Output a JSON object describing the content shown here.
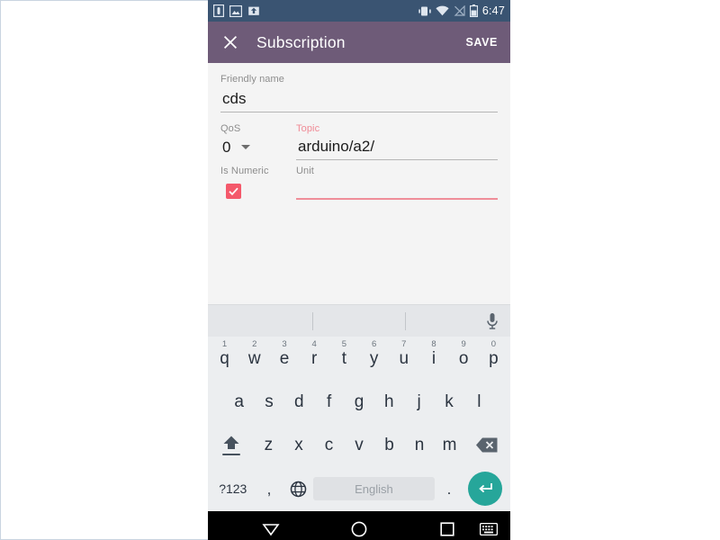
{
  "statusbar": {
    "time": "6:47",
    "left_icons": [
      "sim-card-icon",
      "image-icon",
      "app-update-icon"
    ],
    "right_icons": [
      "vibrate-icon",
      "wifi-icon",
      "signal-off-icon",
      "battery-icon"
    ]
  },
  "toolbar": {
    "close_icon": "close-icon",
    "title": "Subscription",
    "save_label": "SAVE",
    "background": "#6e5b78"
  },
  "form": {
    "friendly_name": {
      "label": "Friendly name",
      "value": "cds",
      "placeholder": ""
    },
    "qos": {
      "label": "QoS",
      "value": "0"
    },
    "topic": {
      "label": "Topic",
      "value": "arduino/a2/",
      "placeholder": "",
      "label_color": "#f08b96"
    },
    "is_numeric": {
      "label": "Is Numeric",
      "checked": true,
      "color": "#f4596b"
    },
    "unit": {
      "label": "Unit",
      "value": "",
      "placeholder": "",
      "underline_color": "#ef8e99"
    }
  },
  "keyboard": {
    "suggestions": [
      "",
      "",
      ""
    ],
    "mic_icon": "microphone-icon",
    "row1": [
      {
        "letter": "q",
        "num": "1"
      },
      {
        "letter": "w",
        "num": "2"
      },
      {
        "letter": "e",
        "num": "3"
      },
      {
        "letter": "r",
        "num": "4"
      },
      {
        "letter": "t",
        "num": "5"
      },
      {
        "letter": "y",
        "num": "6"
      },
      {
        "letter": "u",
        "num": "7"
      },
      {
        "letter": "i",
        "num": "8"
      },
      {
        "letter": "o",
        "num": "9"
      },
      {
        "letter": "p",
        "num": "0"
      }
    ],
    "row2": [
      {
        "letter": "a"
      },
      {
        "letter": "s"
      },
      {
        "letter": "d"
      },
      {
        "letter": "f"
      },
      {
        "letter": "g"
      },
      {
        "letter": "h"
      },
      {
        "letter": "j"
      },
      {
        "letter": "k"
      },
      {
        "letter": "l"
      }
    ],
    "row3": [
      {
        "letter": "z"
      },
      {
        "letter": "x"
      },
      {
        "letter": "c"
      },
      {
        "letter": "v"
      },
      {
        "letter": "b"
      },
      {
        "letter": "n"
      },
      {
        "letter": "m"
      }
    ],
    "shift_icon": "shift-icon",
    "backspace_icon": "backspace-icon",
    "symbols_label": "?123",
    "comma_label": ",",
    "language_icon": "globe-icon",
    "space_label": "English",
    "period_label": ".",
    "enter_icon": "enter-icon",
    "enter_color": "#26a69a"
  },
  "navbar": {
    "back_icon": "back-triangle-icon",
    "home_icon": "home-circle-icon",
    "recents_icon": "recents-square-icon",
    "keyboard_icon": "keyboard-icon"
  }
}
